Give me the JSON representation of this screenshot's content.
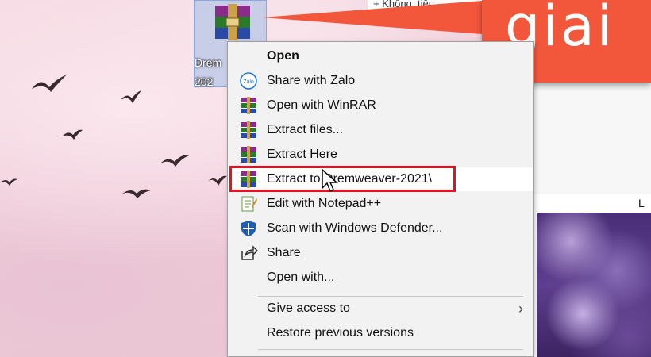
{
  "desktop": {
    "icon_label": "Drem\n202"
  },
  "explorer": {
    "top_text": "+ Không_tiêu",
    "column_label": "L"
  },
  "banner": {
    "text": "giai"
  },
  "context_menu": {
    "items": [
      {
        "label": "Open",
        "icon": "none",
        "bold": true
      },
      {
        "label": "Share with Zalo",
        "icon": "zalo-icon"
      },
      {
        "label": "Open with WinRAR",
        "icon": "winrar-icon"
      },
      {
        "label": "Extract files...",
        "icon": "winrar-icon"
      },
      {
        "label": "Extract Here",
        "icon": "winrar-icon"
      },
      {
        "label": "Extract to Dremweaver-2021\\",
        "icon": "winrar-icon",
        "highlighted": true
      },
      {
        "label": "Edit with Notepad++",
        "icon": "notepad-icon"
      },
      {
        "label": "Scan with Windows Defender...",
        "icon": "defender-icon"
      },
      {
        "label": "Share",
        "icon": "share-icon"
      },
      {
        "label": "Open with...",
        "icon": "none"
      },
      {
        "label": "Give access to",
        "icon": "none",
        "submenu": true
      },
      {
        "label": "Restore previous versions",
        "icon": "none"
      }
    ],
    "submenu_arrow": "›"
  },
  "colors": {
    "banner": "#f2573b",
    "highlight_border": "#e81123",
    "menu_bg": "#f2f2f2"
  }
}
